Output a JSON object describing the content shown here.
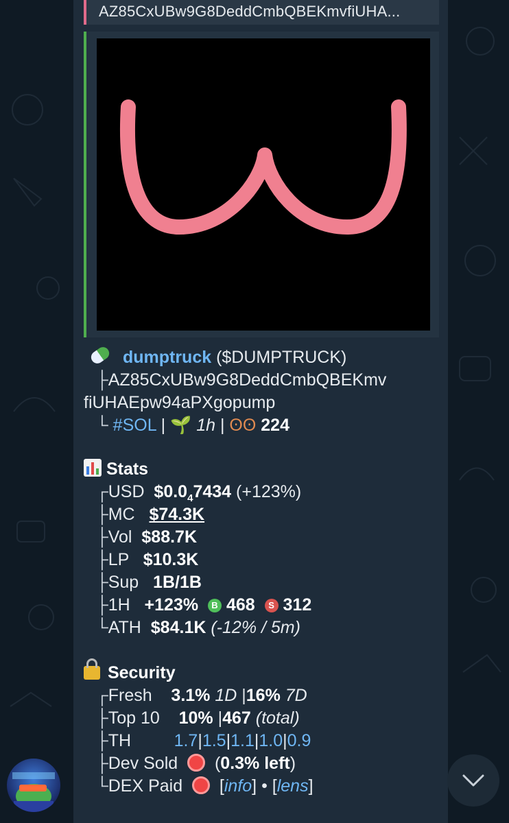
{
  "reply": {
    "text": "AZ85CxUBw9G8DeddCmbQBEKmvfiUHA..."
  },
  "token": {
    "name": "dumptruck",
    "ticker": "($DUMPTRUCK)",
    "address_line1": "AZ85CxUBw9G8DeddCmbQBEKmv",
    "address_line2": "fiUHAEpw94aPXgopump",
    "chain": "#SOL",
    "age": "1h",
    "views": "224"
  },
  "stats": {
    "heading": "Stats",
    "usd_label": "USD",
    "usd_prefix": "$0.0",
    "usd_sub": "4",
    "usd_rest": "7434",
    "usd_change": "(+123%)",
    "mc_label": "MC",
    "mc_value": "$74.3K",
    "vol_label": "Vol",
    "vol_value": "$88.7K",
    "lp_label": "LP",
    "lp_value": "$10.3K",
    "sup_label": "Sup",
    "sup_value": "1B/1B",
    "h1_label": "1H",
    "h1_change": "+123%",
    "buys_badge": "B",
    "buys": "468",
    "sells_badge": "S",
    "sells": "312",
    "ath_label": "ATH",
    "ath_value": "$84.1K",
    "ath_note": "(-12% / 5m)"
  },
  "security": {
    "heading": "Security",
    "fresh_label": "Fresh",
    "fresh_1d": "3.1%",
    "fresh_1d_unit": "1D",
    "fresh_7d": "16%",
    "fresh_7d_unit": "7D",
    "top10_label": "Top 10",
    "top10_pct": "10%",
    "top10_total": "467",
    "top10_total_unit": "(total)",
    "th_label": "TH",
    "th_values": [
      "1.7",
      "1.5",
      "1.1",
      "1.0",
      "0.9"
    ],
    "dev_label": "Dev Sold",
    "dev_left_pct": "0.3% left",
    "dex_label": "DEX Paid",
    "dex_info": "info",
    "dex_lens": "lens"
  },
  "colors": {
    "accent_link": "#6fb6f3",
    "pink_curve": "#f08090",
    "bar_green": "#4fae4e",
    "bar_pink": "#e06a8a"
  }
}
